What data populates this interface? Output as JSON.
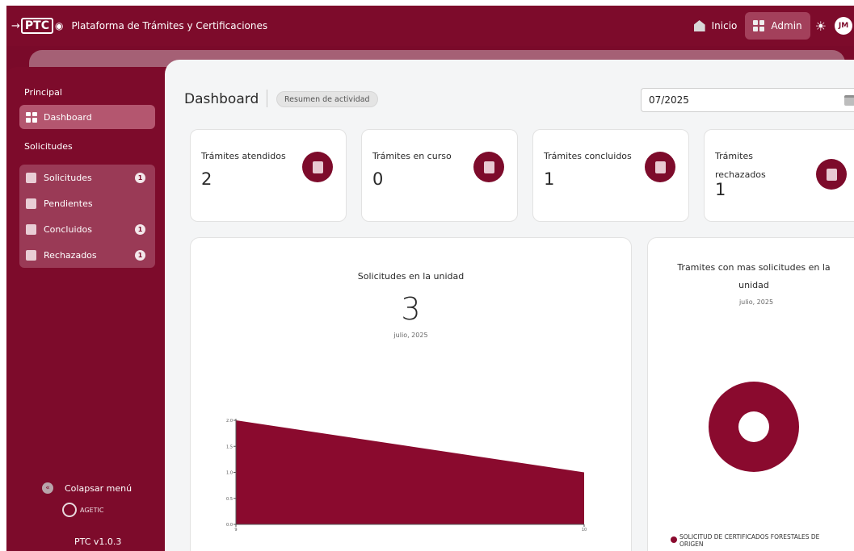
{
  "header": {
    "logo_text": "PTC",
    "app_title": "Plataforma de Trámites y Certificaciones",
    "nav": [
      {
        "label": "Inicio",
        "icon": "home-icon",
        "active": false
      },
      {
        "label": "Admin",
        "icon": "grid-icon",
        "active": true
      }
    ],
    "theme_icon": "sun-icon",
    "avatar_initials": "JM"
  },
  "sidebar": {
    "section_principal": "Principal",
    "dashboard_label": "Dashboard",
    "section_solicitudes": "Solicitudes",
    "items": [
      {
        "label": "Solicitudes",
        "badge": "1"
      },
      {
        "label": "Pendientes",
        "badge": ""
      },
      {
        "label": "Concluidos",
        "badge": "1"
      },
      {
        "label": "Rechazados",
        "badge": "1"
      }
    ],
    "collapse_label": "Colapsar menú",
    "org_logo_text": "AGETIC",
    "version": "PTC v1.0.3"
  },
  "main": {
    "title": "Dashboard",
    "subtitle_pill": "Resumen de actividad",
    "date_value": "07/2025"
  },
  "cards": [
    {
      "label": "Trámites atendidos",
      "value": "2"
    },
    {
      "label": "Trámites en curso",
      "value": "0"
    },
    {
      "label": "Trámites concluidos",
      "value": "1"
    },
    {
      "label": "Trámites rechazados",
      "value": "1"
    }
  ],
  "area_panel": {
    "title": "Solicitudes en la unidad",
    "total": "3",
    "period": "julio, 2025"
  },
  "pie_panel": {
    "title": "Tramites con mas solicitudes en la unidad",
    "period": "julio, 2025",
    "legend": "SOLICITUD DE CERTIFICADOS FORESTALES DE ORIGEN"
  },
  "colors": {
    "brand": "#7d0b2b",
    "chart_fill": "#8a0a2e"
  },
  "chart_data": [
    {
      "type": "area",
      "x": [
        9,
        10
      ],
      "values": [
        2.0,
        1.0
      ],
      "yticks": [
        "0.0",
        "0.5",
        "1.0",
        "1.5",
        "2.0"
      ],
      "xticks": [
        "9",
        "10"
      ],
      "ylim": [
        0,
        2.0
      ]
    },
    {
      "type": "pie",
      "labels": [
        "SOLICITUD DE CERTIFICADOS FORESTALES DE ORIGEN"
      ],
      "values": [
        100
      ],
      "donut": true
    }
  ]
}
